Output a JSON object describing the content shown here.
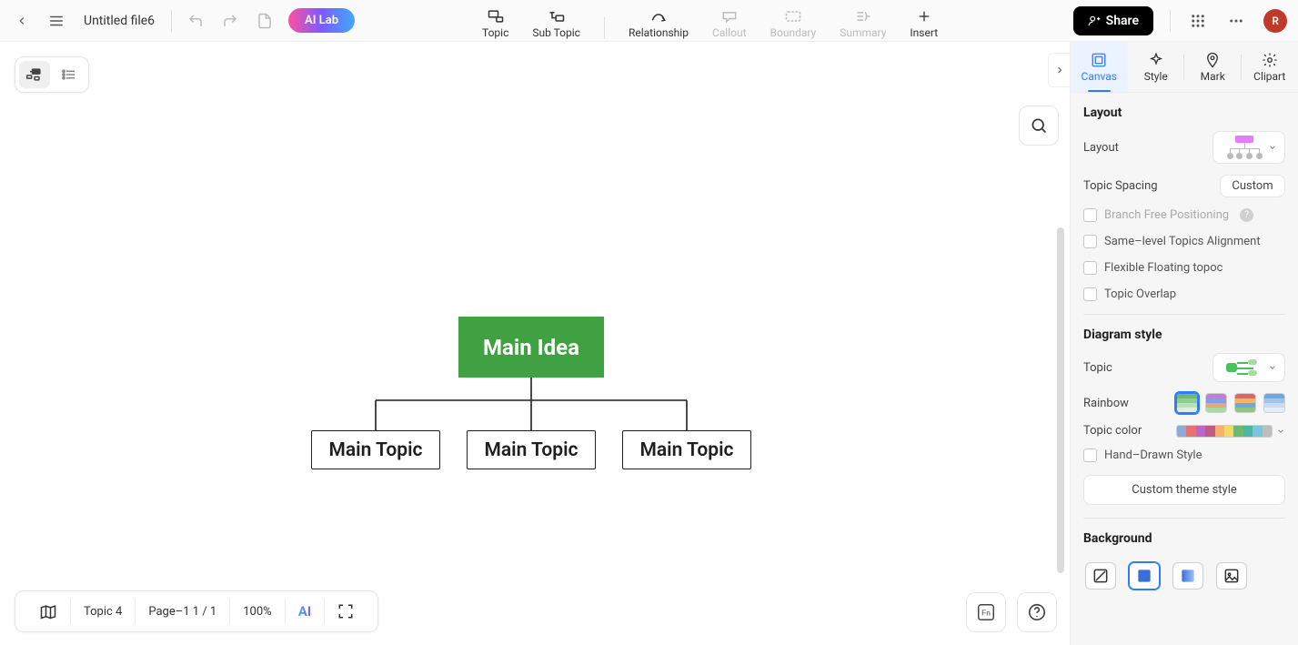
{
  "header": {
    "filename": "Untitled file6",
    "ailab": "AI Lab",
    "tools": {
      "topic": "Topic",
      "subtopic": "Sub Topic",
      "relationship": "Relationship",
      "callout": "Callout",
      "boundary": "Boundary",
      "summary": "Summary",
      "insert": "Insert"
    },
    "share": "Share",
    "avatar": "R"
  },
  "mindmap": {
    "root": "Main Idea",
    "topics": [
      "Main Topic",
      "Main Topic",
      "Main Topic"
    ]
  },
  "bottom": {
    "topic_count": "Topic 4",
    "page": "Page–1  1 / 1",
    "zoom": "100%",
    "ai": "AI"
  },
  "panel": {
    "tabs": {
      "canvas": "Canvas",
      "style": "Style",
      "mark": "Mark",
      "clipart": "Clipart"
    },
    "layout_title": "Layout",
    "layout_label": "Layout",
    "spacing_label": "Topic Spacing",
    "spacing_value": "Custom",
    "branch_free": "Branch Free Positioning",
    "same_level": "Same–level Topics Alignment",
    "flexible": "Flexible Floating topoc",
    "overlap": "Topic Overlap",
    "diagram_title": "Diagram style",
    "topic_label": "Topic",
    "rainbow_label": "Rainbow",
    "topiccolor_label": "Topic color",
    "handdrawn": "Hand–Drawn Style",
    "custom_theme": "Custom theme style",
    "background_title": "Background"
  },
  "colors": {
    "rainbow_palettes": [
      [
        "#6db96f",
        "#8fce91",
        "#b7e2b8",
        "#d9f0da"
      ],
      [
        "#c77bd9",
        "#8b9be6",
        "#e6a67b",
        "#a7dca0"
      ],
      [
        "#e06666",
        "#f6b26b",
        "#6fa8dc",
        "#93c47d"
      ],
      [
        "#6fa8dc",
        "#9fc5e8",
        "#c9daf8",
        "#e2edf9"
      ]
    ],
    "topic_colors": [
      "#8fa8d6",
      "#e57373",
      "#ba68c8",
      "#c05a8a",
      "#f6b26b",
      "#f2d96b",
      "#6db96f",
      "#4fb5a6",
      "#7bc6de",
      "#bdbdbd"
    ]
  }
}
